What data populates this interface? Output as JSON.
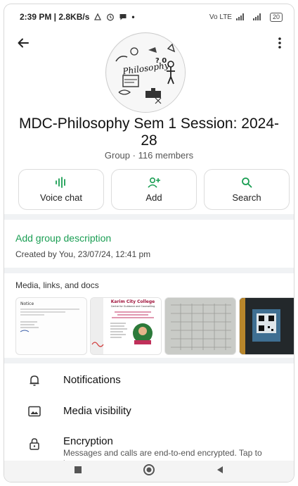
{
  "status_bar": {
    "time_speed": "2:39 PM | 2.8KB/s",
    "notif_icons": [
      "signal-icon",
      "alarm-icon",
      "chat-bubble-icon"
    ],
    "dot": "•",
    "network_labels": "Vo LTE",
    "battery": "20"
  },
  "header": {
    "back_icon": "arrow-left-icon",
    "menu_icon": "more-vertical-icon",
    "avatar_text": "Philosophy"
  },
  "group": {
    "name": "MDC-Philosophy Sem 1 Session: 2024-28",
    "meta": "Group · 116 members"
  },
  "actions": [
    {
      "label": "Voice chat",
      "icon": "voice-wave-icon"
    },
    {
      "label": "Add",
      "icon": "add-person-icon"
    },
    {
      "label": "Search",
      "icon": "search-icon"
    }
  ],
  "description": {
    "add_label": "Add group description",
    "created": "Created by You, 23/07/24, 12:41 pm"
  },
  "media": {
    "title": "Media, links, and docs",
    "thumb1_heading": "Notice",
    "thumb2_college": "Karim City College",
    "thumb2_sub": "Centre for Guidance and Counselling"
  },
  "settings": [
    {
      "title": "Notifications",
      "icon": "bell-icon"
    },
    {
      "title": "Media visibility",
      "icon": "image-icon"
    },
    {
      "title": "Encryption",
      "icon": "lock-icon",
      "subtitle": "Messages and calls are end-to-end encrypted. Tap to learn more."
    }
  ],
  "colors": {
    "accent": "#1a9e53",
    "separator": "#f0f2f4"
  }
}
